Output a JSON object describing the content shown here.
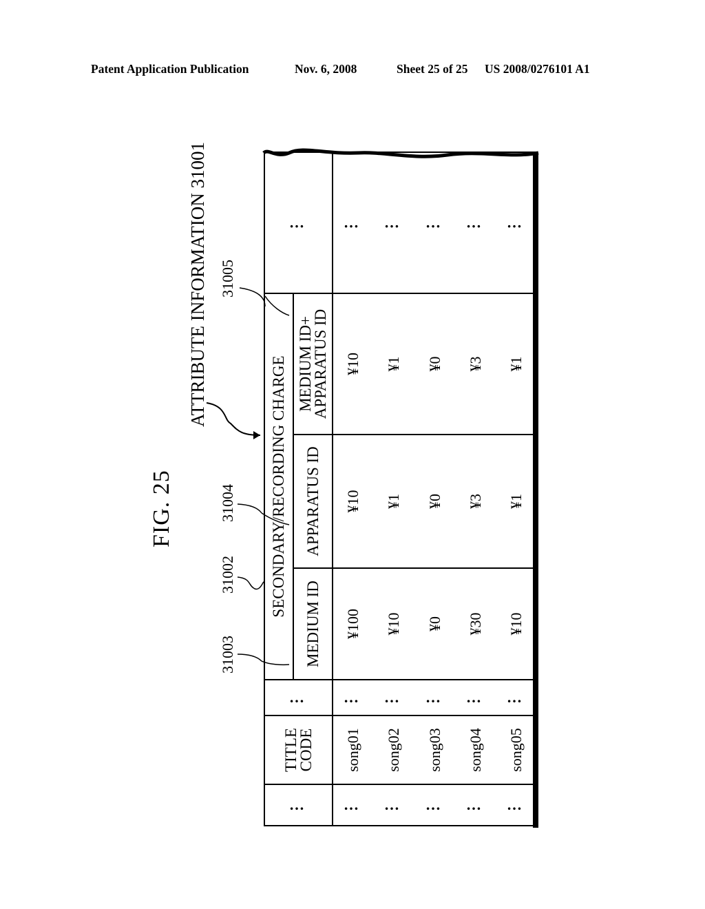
{
  "header": {
    "publication": "Patent Application Publication",
    "date": "Nov. 6, 2008",
    "sheet": "Sheet 25 of 25",
    "number": "US 2008/0276101 A1"
  },
  "figure": {
    "label": "FIG. 25",
    "title": "ATTRIBUTE INFORMATION 31001",
    "refs": {
      "r31005": "31005",
      "r31004": "31004",
      "r31002": "31002",
      "r31003": "31003"
    }
  },
  "table": {
    "ellipsis": "…",
    "title_code_header": "TITLE\nCODE",
    "group_header": "SECONDARY/RECORDING CHARGE",
    "sub_headers": [
      "MEDIUM ID",
      "APPARATUS ID",
      "MEDIUM ID+\nAPPARATUS ID"
    ],
    "rows": [
      {
        "title_code": "song01",
        "medium_id": "¥100",
        "apparatus_id": "¥10",
        "medium_apparatus_id": "¥10"
      },
      {
        "title_code": "song02",
        "medium_id": "¥10",
        "apparatus_id": "¥1",
        "medium_apparatus_id": "¥1"
      },
      {
        "title_code": "song03",
        "medium_id": "¥0",
        "apparatus_id": "¥0",
        "medium_apparatus_id": "¥0"
      },
      {
        "title_code": "song04",
        "medium_id": "¥30",
        "apparatus_id": "¥3",
        "medium_apparatus_id": "¥3"
      },
      {
        "title_code": "song05",
        "medium_id": "¥10",
        "apparatus_id": "¥1",
        "medium_apparatus_id": "¥1"
      }
    ]
  }
}
